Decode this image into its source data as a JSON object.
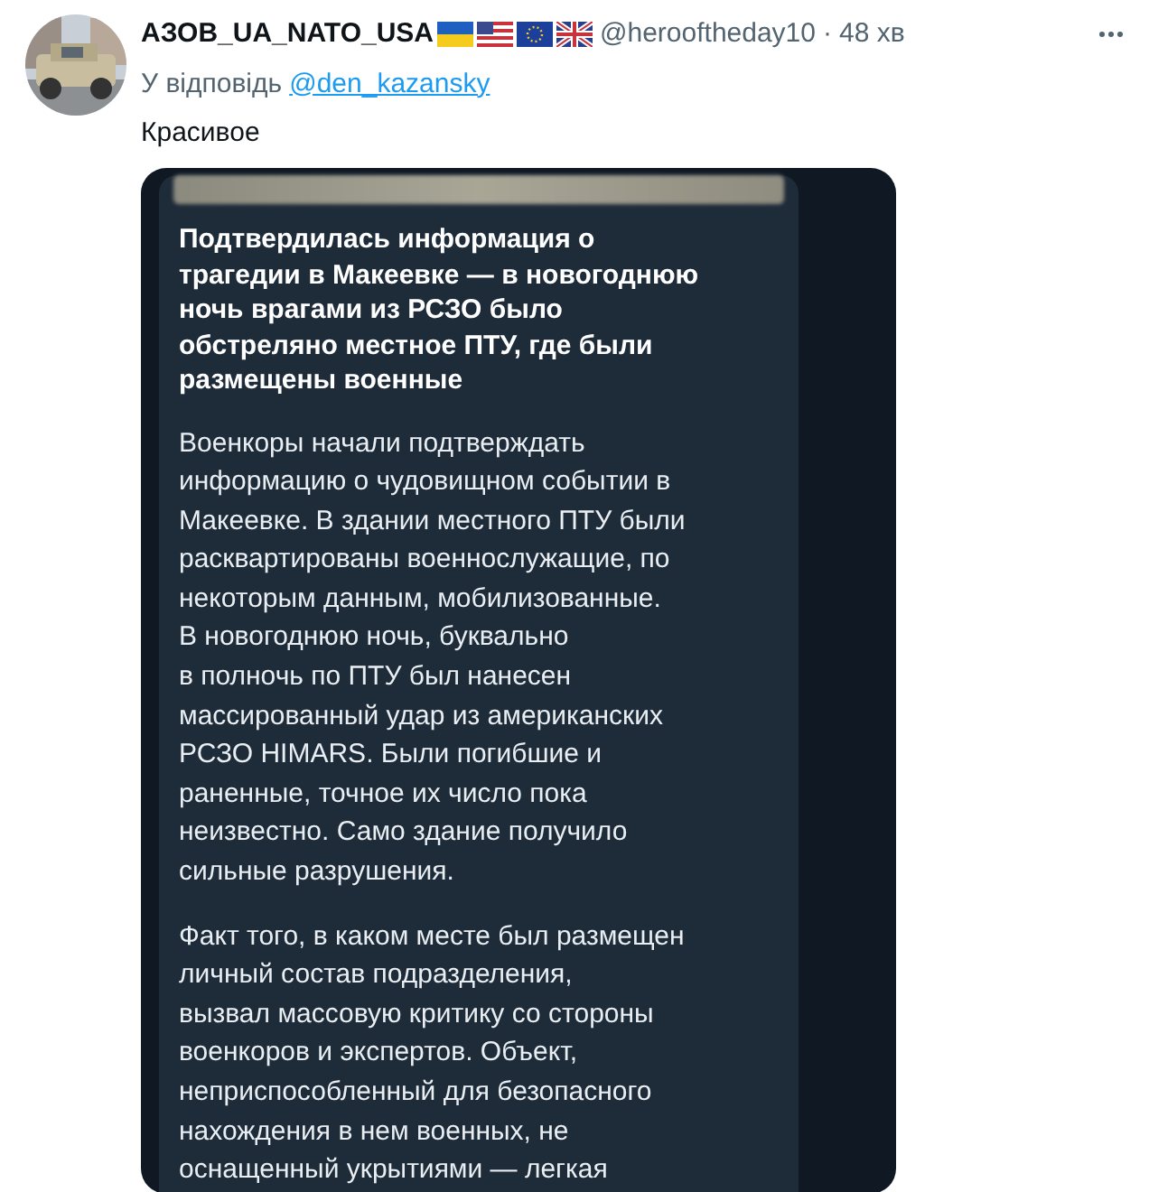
{
  "tweet": {
    "display_name": "АЗОВ_UA_NATO_USA",
    "flags": [
      {
        "kind": "ukraine"
      },
      {
        "kind": "usa"
      },
      {
        "kind": "eu"
      },
      {
        "kind": "uk"
      }
    ],
    "handle": "@herooftheday10",
    "separator": "·",
    "time": "48 хв",
    "reply_prefix": "У відповідь",
    "reply_to": "@den_kazansky",
    "text": "Красивое",
    "media": {
      "kind": "screenshot",
      "message": {
        "title": [
          "Подтвердилась информация о",
          "трагедии в Макеевке — в новогоднюю",
          "ночь врагами из РСЗО было",
          "обстреляно местное ПТУ, где были",
          "размещены военные"
        ],
        "paragraphs": [
          [
            "Военкоры начали подтверждать",
            "информацию о чудовищном событии в",
            "Макеевке. В здании местного ПТУ были",
            "расквартированы военнослужащие, по",
            "некоторым данным, мобилизованные.",
            "В новогоднюю ночь, буквально",
            "в полночь по ПТУ был нанесен",
            "массированный удар из американских",
            "РСЗО HIMARS. Были погибшие и",
            "раненные, точное их число пока",
            "неизвестно. Само здание получило",
            "сильные разрушения."
          ],
          [
            "Факт того, в каком месте был размещен",
            "личный состав подразделения,",
            "вызвал массовую критику со стороны",
            "военкоров и экспертов. Объект,",
            "неприспособленный для безопасного",
            "нахождения в нем военных, не",
            "оснащенный укрытиями — легкая"
          ]
        ]
      }
    }
  }
}
